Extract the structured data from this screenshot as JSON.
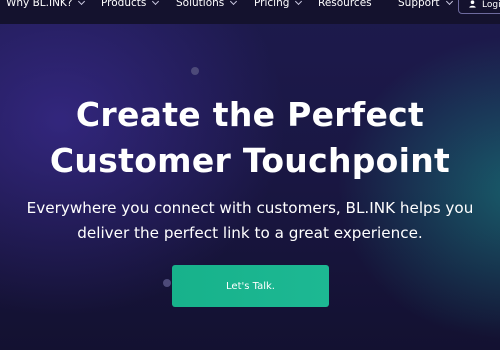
{
  "nav": {
    "items": [
      {
        "label": "Why BL.INK?",
        "has_dropdown": true
      },
      {
        "label": "Products",
        "has_dropdown": true
      },
      {
        "label": "Solutions",
        "has_dropdown": true
      },
      {
        "label": "Pricing",
        "has_dropdown": true
      },
      {
        "label": "Resources",
        "has_dropdown": false
      },
      {
        "label": "Support",
        "has_dropdown": true
      }
    ],
    "login_label": "Login",
    "login_icon": "user-icon"
  },
  "hero": {
    "title_line1": "Create the Perfect",
    "title_line2": "Customer Touchpoint",
    "subtitle_line1": "Everywhere you connect with customers, BL.INK helps you",
    "subtitle_line2": "deliver the perfect link to a great experience.",
    "cta_label": "Let's Talk."
  },
  "colors": {
    "background": "#1a1744",
    "nav_background": "#14122e",
    "accent": "#1db893",
    "text": "#ffffff"
  }
}
